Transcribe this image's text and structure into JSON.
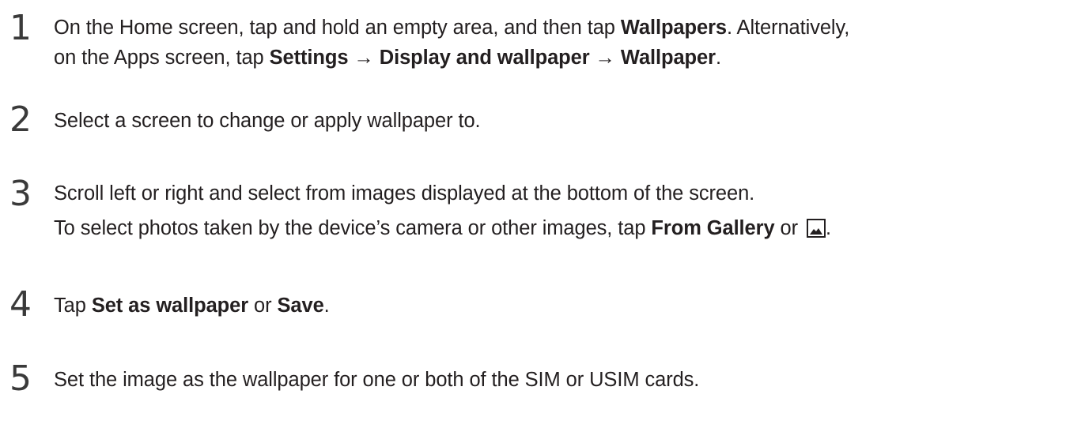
{
  "steps": [
    {
      "number": "1",
      "line1": {
        "t1": "On the Home screen, tap and hold an empty area, and then tap ",
        "b1": "Wallpapers",
        "t2": ". Alternatively,"
      },
      "line2": {
        "t1": "on the Apps screen, tap ",
        "b1": "Settings",
        "arrow1": " → ",
        "b2": "Display and wallpaper",
        "arrow2": " → ",
        "b3": "Wallpaper",
        "t2": "."
      }
    },
    {
      "number": "2",
      "text": "Select a screen to change or apply wallpaper to."
    },
    {
      "number": "3",
      "text": "Scroll left or right and select from images displayed at the bottom of the screen.",
      "note": {
        "t1": "To select photos taken by the device’s camera or other images, tap ",
        "b1": "From Gallery",
        "t2": " or ",
        "icon": "gallery-icon",
        "t3": "."
      }
    },
    {
      "number": "4",
      "t1": "Tap ",
      "b1": "Set as wallpaper",
      "t2": " or ",
      "b2": "Save",
      "t3": "."
    },
    {
      "number": "5",
      "text": "Set the image as the wallpaper for one or both of the SIM or USIM cards."
    }
  ]
}
